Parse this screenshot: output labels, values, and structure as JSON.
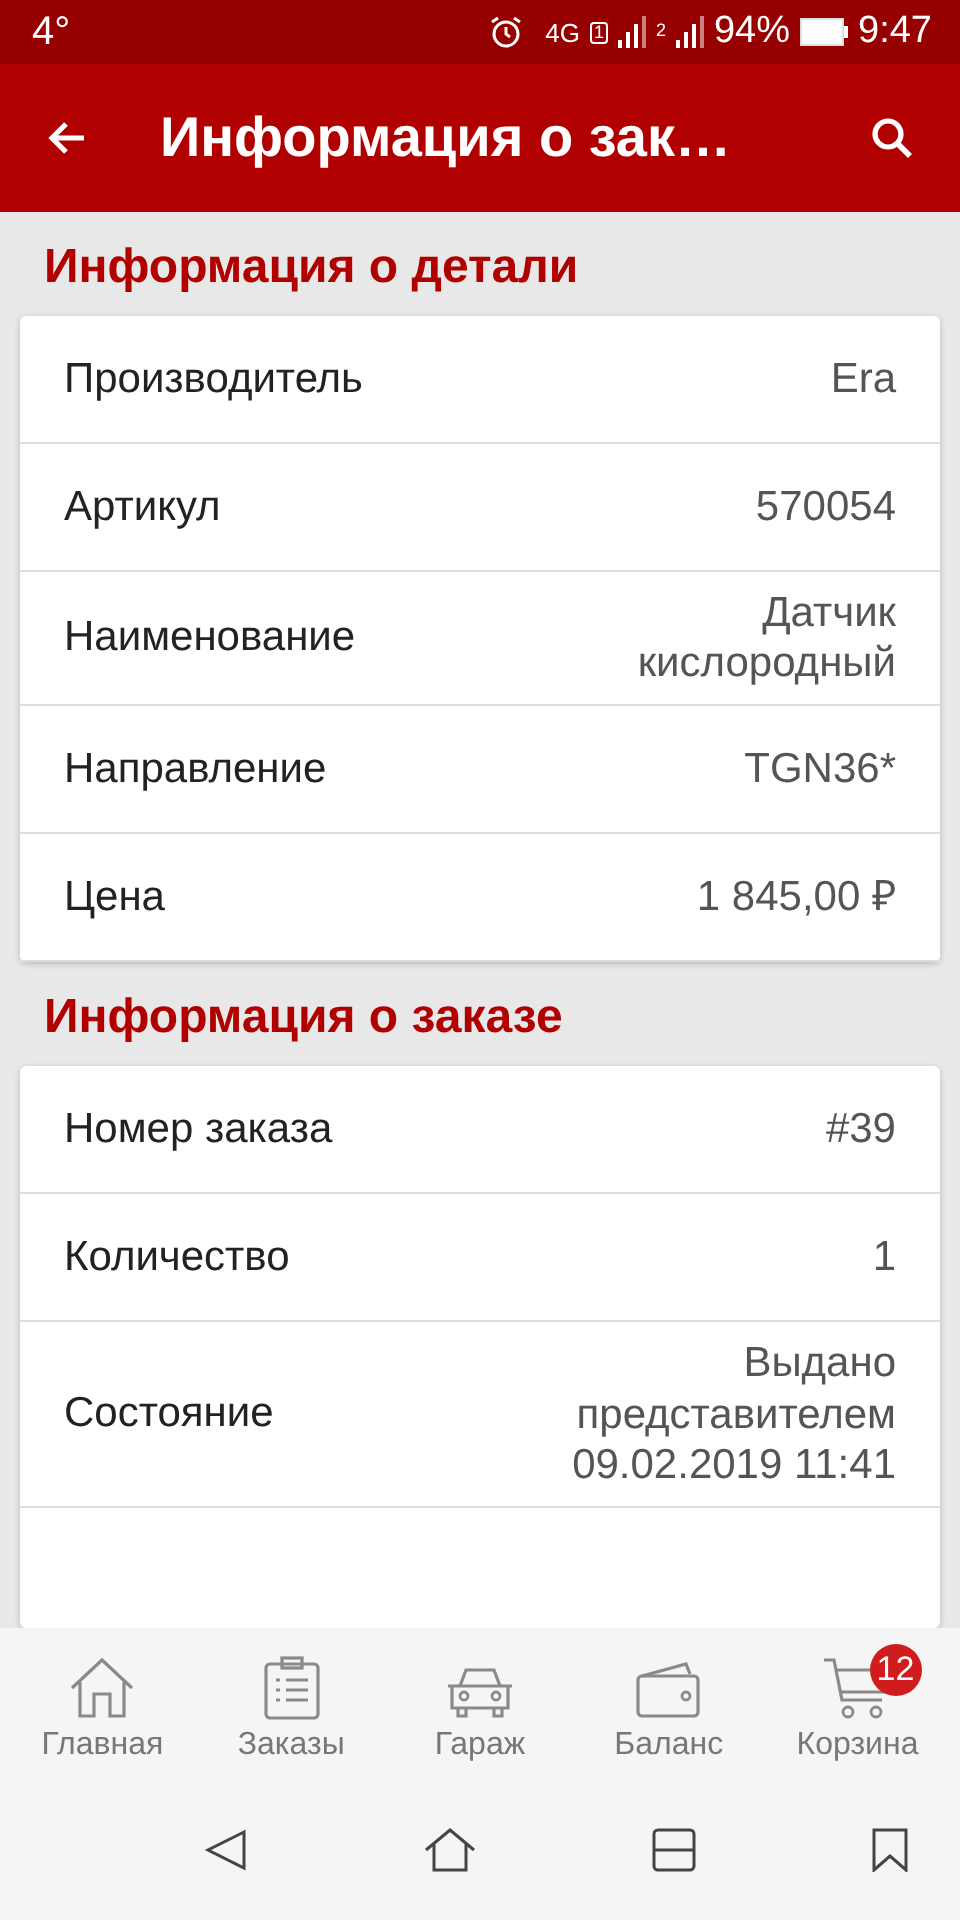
{
  "status_bar": {
    "temperature": "4°",
    "network": "4G",
    "sims": [
      "1",
      "2"
    ],
    "battery": "94%",
    "time": "9:47"
  },
  "app_bar": {
    "title": "Информация о зак…"
  },
  "sections": [
    {
      "title": "Информация о детали",
      "rows": [
        {
          "label": "Производитель",
          "value": "Era"
        },
        {
          "label": "Артикул",
          "value": "570054"
        },
        {
          "label": "Наименование",
          "value": "Датчик кислородный"
        },
        {
          "label": "Направление",
          "value": "TGN36*"
        },
        {
          "label": "Цена",
          "value": "1 845,00 ₽"
        }
      ]
    },
    {
      "title": "Информация о заказе",
      "rows": [
        {
          "label": "Номер заказа",
          "value": "#39"
        },
        {
          "label": "Количество",
          "value": "1"
        },
        {
          "label": "Состояние",
          "value": "Выдано представителем 09.02.2019 11:41"
        }
      ]
    }
  ],
  "bottom_nav": [
    {
      "kind": "home",
      "label": "Главная"
    },
    {
      "kind": "orders",
      "label": "Заказы"
    },
    {
      "kind": "garage",
      "label": "Гараж"
    },
    {
      "kind": "balance",
      "label": "Баланс"
    },
    {
      "kind": "cart",
      "label": "Корзина",
      "badge": "12"
    }
  ]
}
